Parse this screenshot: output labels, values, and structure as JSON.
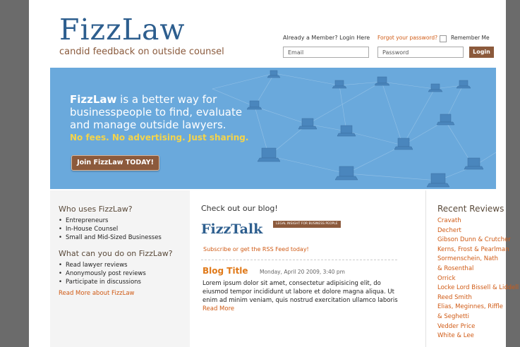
{
  "header": {
    "logo_text": "FizzLaw",
    "tagline": "candid feedback on outside counsel"
  },
  "login": {
    "member_text": "Already a Member? Login Here",
    "forgot_password": "Forgot your password?",
    "remember_me": "Remember Me",
    "email_placeholder": "Email",
    "password_placeholder": "Password",
    "login_button": "Login"
  },
  "hero": {
    "brand": "FizzLaw",
    "headline_rest": " is a better way for businesspeople to find, evaluate and manage outside lawyers.",
    "tagline": "No fees. No advertising. Just sharing.",
    "join_button": "Join FizzLaw TODAY!"
  },
  "left": {
    "who_title": "Who uses FizzLaw?",
    "who_items": [
      "Entrepreneurs",
      "In-House Counsel",
      "Small and Mid-Sized Businesses"
    ],
    "what_title": "What can you do on FizzLaw?",
    "what_items": [
      "Read lawyer reviews",
      "Anonymously post reviews",
      "Participate in discussions"
    ],
    "read_more": "Read More about FizzLaw"
  },
  "blog": {
    "heading": "Check out our blog!",
    "logo_text": "FizzTalk",
    "legal_tag": "LEGAL INSIGHT FOR BUSINESS PEOPLE",
    "subscribe": "Subscribe or get the RSS Feed today!",
    "post_title": "Blog Title",
    "post_date": "Monday, April 20 2009, 3:40 pm",
    "post_body": "Lorem ipsum dolor sit amet, consectetur adipisicing elit, do eiusmod tempor incididunt ut labore et dolore magna aliqua. Ut enim ad minim veniam, quis nostrud exercitation ullamco laboris ",
    "read_more": "Read More"
  },
  "recent": {
    "title": "Recent Reviews",
    "items": [
      "Cravath",
      "Dechert",
      "Gibson Dunn & Crutcher",
      "Kerns, Frost & Pearlman",
      "Sormenschein, Nath",
      "& Rosenthal",
      "Orrick",
      "Locke Lord Bissell & Liddell",
      "Reed Smith",
      "Elias, Meginnes, Riffle",
      "& Seghetti",
      "Vedder Price",
      "White & Lee"
    ]
  },
  "colors": {
    "brand_blue": "#2d5e8e",
    "hero_blue": "#6aa9dc",
    "accent_brown": "#8c5a3c",
    "link_orange": "#d05a14",
    "highlight_yellow": "#f4d44a"
  }
}
